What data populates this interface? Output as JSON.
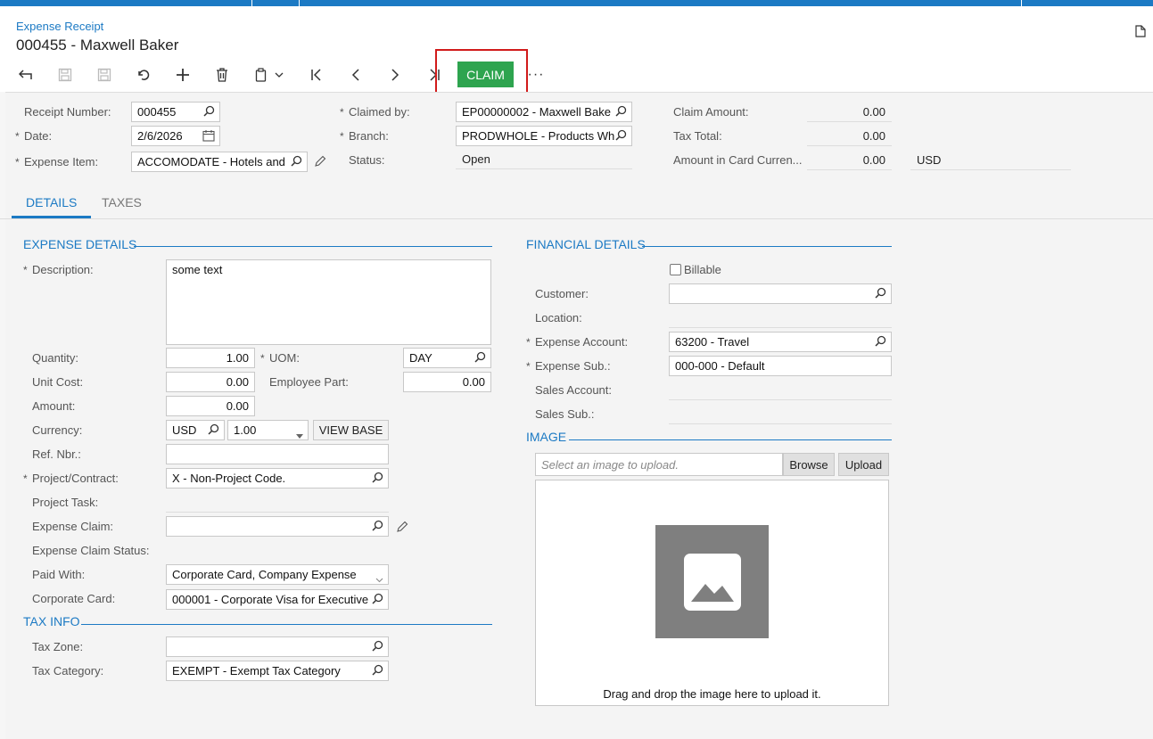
{
  "header": {
    "screen_title": "Expense Receipt",
    "record_title": "000455 - Maxwell Baker"
  },
  "toolbar": {
    "claim_label": "CLAIM",
    "more_label": "···"
  },
  "summary": {
    "receipt_number_label": "Receipt Number:",
    "receipt_number": "000455",
    "date_label": "Date:",
    "date": "2/6/2026",
    "expense_item_label": "Expense Item:",
    "expense_item": "ACCOMODATE - Hotels and",
    "claimed_by_label": "Claimed by:",
    "claimed_by": "EP00000002 - Maxwell Bake",
    "branch_label": "Branch:",
    "branch": "PRODWHOLE - Products Wh",
    "status_label": "Status:",
    "status": "Open",
    "claim_amount_label": "Claim Amount:",
    "claim_amount": "0.00",
    "tax_total_label": "Tax Total:",
    "tax_total": "0.00",
    "amount_card_label": "Amount in Card Curren...",
    "amount_card": "0.00",
    "card_currency": "USD"
  },
  "tabs": [
    {
      "label": "DETAILS",
      "active": true
    },
    {
      "label": "TAXES",
      "active": false
    }
  ],
  "expense_details": {
    "section_title": "EXPENSE DETAILS",
    "description_label": "Description:",
    "description": "some text",
    "quantity_label": "Quantity:",
    "quantity": "1.00",
    "uom_label": "UOM:",
    "uom": "DAY",
    "unit_cost_label": "Unit Cost:",
    "unit_cost": "0.00",
    "employee_part_label": "Employee Part:",
    "employee_part": "0.00",
    "amount_label": "Amount:",
    "amount": "0.00",
    "currency_label": "Currency:",
    "currency": "USD",
    "currency_rate": "1.00",
    "view_base_label": "VIEW BASE",
    "ref_nbr_label": "Ref. Nbr.:",
    "ref_nbr": "",
    "project_label": "Project/Contract:",
    "project": "X - Non-Project Code.",
    "project_task_label": "Project Task:",
    "expense_claim_label": "Expense Claim:",
    "expense_claim": "",
    "expense_claim_status_label": "Expense Claim Status:",
    "paid_with_label": "Paid With:",
    "paid_with": "Corporate Card, Company Expense",
    "corporate_card_label": "Corporate Card:",
    "corporate_card": "000001 - Corporate Visa for Executive"
  },
  "tax_info": {
    "section_title": "TAX INFO",
    "tax_zone_label": "Tax Zone:",
    "tax_zone": "",
    "tax_category_label": "Tax Category:",
    "tax_category": "EXEMPT - Exempt Tax Category"
  },
  "financial_details": {
    "section_title": "FINANCIAL DETAILS",
    "billable_label": "Billable",
    "billable": false,
    "customer_label": "Customer:",
    "customer": "",
    "location_label": "Location:",
    "expense_account_label": "Expense Account:",
    "expense_account": "63200 - Travel",
    "expense_sub_label": "Expense Sub.:",
    "expense_sub": "000-000 - Default",
    "sales_account_label": "Sales Account:",
    "sales_sub_label": "Sales Sub.:"
  },
  "image": {
    "section_title": "IMAGE",
    "file_placeholder": "Select an image to upload.",
    "browse_label": "Browse",
    "upload_label": "Upload",
    "drop_text": "Drag and drop the image here to upload it."
  },
  "colors": {
    "accent": "#1c7ac4",
    "claim_green": "#2ea44f",
    "highlight_red": "#d11b1b"
  }
}
